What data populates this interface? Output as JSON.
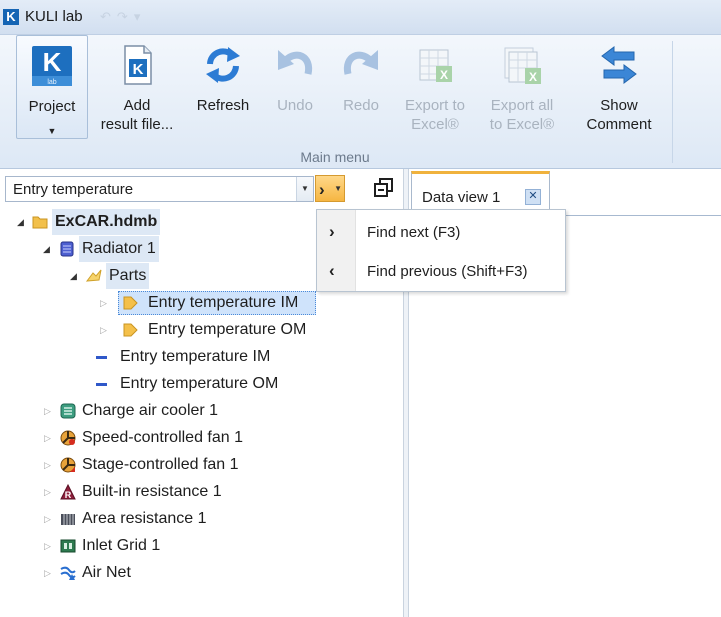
{
  "window": {
    "title": "KULI lab",
    "logo_letter": "K"
  },
  "ribbon": {
    "buttons": [
      {
        "id": "project",
        "label": "Project",
        "enabled": true
      },
      {
        "id": "add",
        "label1": "Add",
        "label2": "result file...",
        "enabled": true
      },
      {
        "id": "refresh",
        "label": "Refresh",
        "enabled": true
      },
      {
        "id": "undo",
        "label": "Undo",
        "enabled": false
      },
      {
        "id": "redo",
        "label": "Redo",
        "enabled": false
      },
      {
        "id": "export",
        "label1": "Export to",
        "label2": "Excel®",
        "enabled": false
      },
      {
        "id": "exportall",
        "label1": "Export all",
        "label2": "to Excel®",
        "enabled": false
      },
      {
        "id": "comment",
        "label1": "Show",
        "label2": "Comment",
        "enabled": true
      }
    ],
    "group_label": "Main menu"
  },
  "search": {
    "value": "Entry temperature"
  },
  "find_menu": {
    "items": [
      {
        "label": "Find next (F3)",
        "icon": "chevron-right-icon"
      },
      {
        "label": "Find previous (Shift+F3)",
        "icon": "chevron-left-icon"
      }
    ]
  },
  "tabs": [
    {
      "label": "Data view 1"
    }
  ],
  "tree": {
    "root": "ExCAR.hdmb",
    "radiator": "Radiator 1",
    "parts": "Parts",
    "part_im": "Entry temperature IM",
    "part_om": "Entry temperature OM",
    "entry_im": "Entry temperature IM",
    "entry_om": "Entry temperature OM",
    "components": [
      {
        "label": "Charge air cooler 1",
        "icon": "cooler-icon"
      },
      {
        "label": "Speed-controlled fan 1",
        "icon": "fan-icon"
      },
      {
        "label": "Stage-controlled fan 1",
        "icon": "fan-icon"
      },
      {
        "label": "Built-in resistance 1",
        "icon": "resistance-icon"
      },
      {
        "label": "Area resistance 1",
        "icon": "area-resistance-icon"
      },
      {
        "label": "Inlet Grid 1",
        "icon": "grid-icon"
      },
      {
        "label": "Air Net",
        "icon": "air-net-icon"
      }
    ]
  },
  "colors": {
    "accent": "#f0b23d",
    "selection": "#cfe3fb",
    "ribbon": "#dde8f5"
  }
}
